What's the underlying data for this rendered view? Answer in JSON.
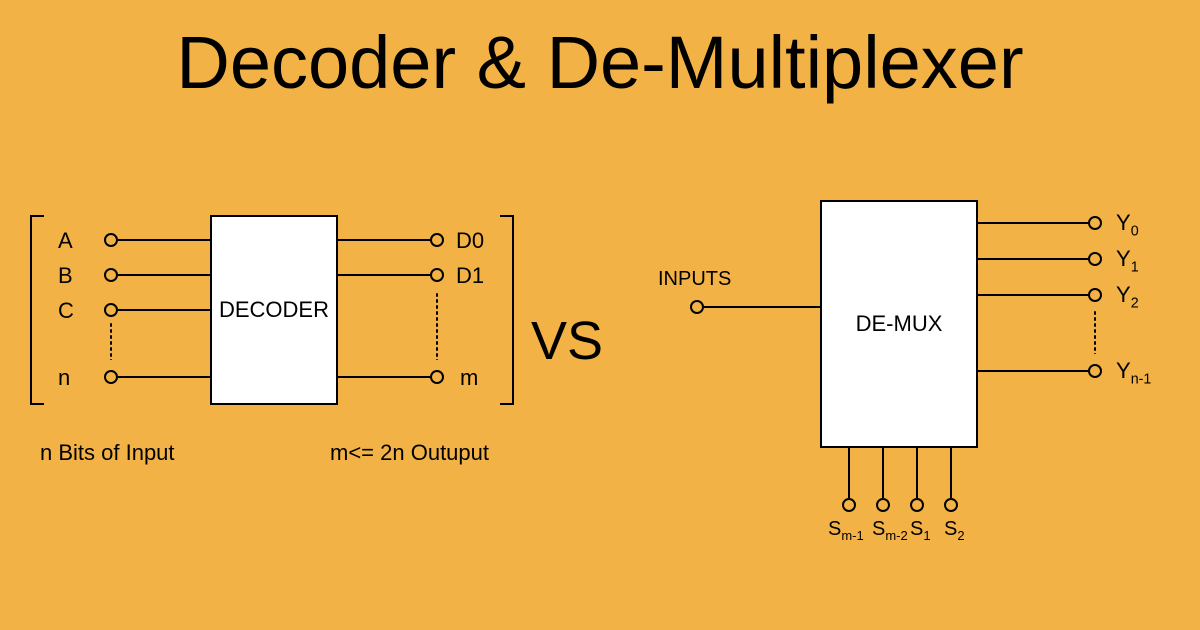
{
  "title": "Decoder & De-Multiplexer",
  "vs": "VS",
  "decoder": {
    "box_label": "DECODER",
    "inputs": [
      "A",
      "B",
      "C",
      "n"
    ],
    "outputs": [
      "D0",
      "D1",
      "m"
    ],
    "input_caption": "n Bits of Input",
    "output_caption": "m<= 2n Outuput"
  },
  "demux": {
    "box_label": "DE-MUX",
    "input_label": "INPUTS",
    "outputs": [
      {
        "base": "Y",
        "sub": "0"
      },
      {
        "base": "Y",
        "sub": "1"
      },
      {
        "base": "Y",
        "sub": "2"
      },
      {
        "base": "Y",
        "sub": "n-1"
      }
    ],
    "selects": [
      {
        "base": "S",
        "sub": "m-1"
      },
      {
        "base": "S",
        "sub": "m-2"
      },
      {
        "base": "S",
        "sub": "1"
      },
      {
        "base": "S",
        "sub": "2"
      }
    ]
  }
}
